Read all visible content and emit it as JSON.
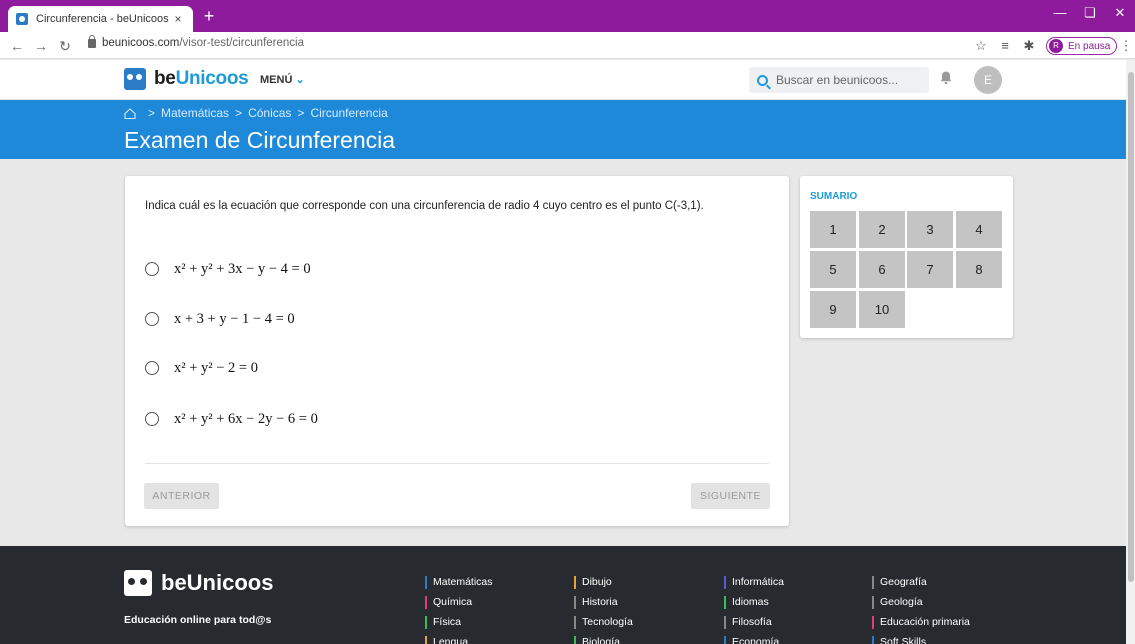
{
  "browser": {
    "tab_title": "Circunferencia - beUnicoos",
    "tab_close": "×",
    "new_tab": "+",
    "url_domain": "beunicoos.com",
    "url_path": "/visor-test/circunferencia",
    "profile_initial": "R",
    "profile_status": "En pausa"
  },
  "header": {
    "logo_pre": "be",
    "logo_highlight": "Unicoos",
    "menu_label": "MENÚ",
    "search_placeholder": "Buscar en beunicoos...",
    "user_initial": "E"
  },
  "banner": {
    "breadcrumb": [
      "Matemáticas",
      "Cónicas",
      "Circunferencia"
    ],
    "title": "Examen de Circunferencia"
  },
  "exam": {
    "question": "Indica cuál es la ecuación que corresponde con una circunferencia de radio 4 cuyo centro es el punto C(-3,1).",
    "options": [
      {
        "label": "x² + y² + 3x − y − 4 = 0"
      },
      {
        "label": "x + 3 + y − 1 − 4 = 0"
      },
      {
        "label": "x² + y² − 2 = 0"
      },
      {
        "label": "x² + y² + 6x − 2y − 6 = 0"
      }
    ],
    "prev_label": "ANTERIOR",
    "next_label": "SIGUIENTE"
  },
  "summary": {
    "title": "SUMARIO",
    "items": [
      "1",
      "2",
      "3",
      "4",
      "5",
      "6",
      "7",
      "8",
      "9",
      "10"
    ]
  },
  "footer": {
    "brand": "beUnicoos",
    "tagline": "Educación online para tod@s",
    "columns": [
      {
        "color": "#2a7cc7",
        "links": [
          "Matemáticas",
          "Química",
          "Física",
          "Lengua"
        ]
      },
      {
        "color": "#e8a23a",
        "links": [
          "Dibujo",
          "Historia",
          "Tecnología",
          "Biología"
        ]
      },
      {
        "color": "#5a5ad8",
        "links": [
          "Informática",
          "Idiomas",
          "Filosofía",
          "Economía"
        ]
      },
      {
        "color": "#9a9a9a",
        "links": [
          "Geografía",
          "Geología",
          "Educación primaria",
          "Soft Skills"
        ]
      }
    ],
    "link_colors": [
      [
        "#2a7cc7",
        "#e0407a",
        "#3dbb5a",
        "#e8a23a"
      ],
      [
        "#e8a23a",
        "#888888",
        "#888888",
        "#3dbb5a"
      ],
      [
        "#5a5ad8",
        "#3dbb5a",
        "#888888",
        "#2a7cc7"
      ],
      [
        "#888888",
        "#888888",
        "#e0407a",
        "#2a7cc7"
      ]
    ]
  }
}
